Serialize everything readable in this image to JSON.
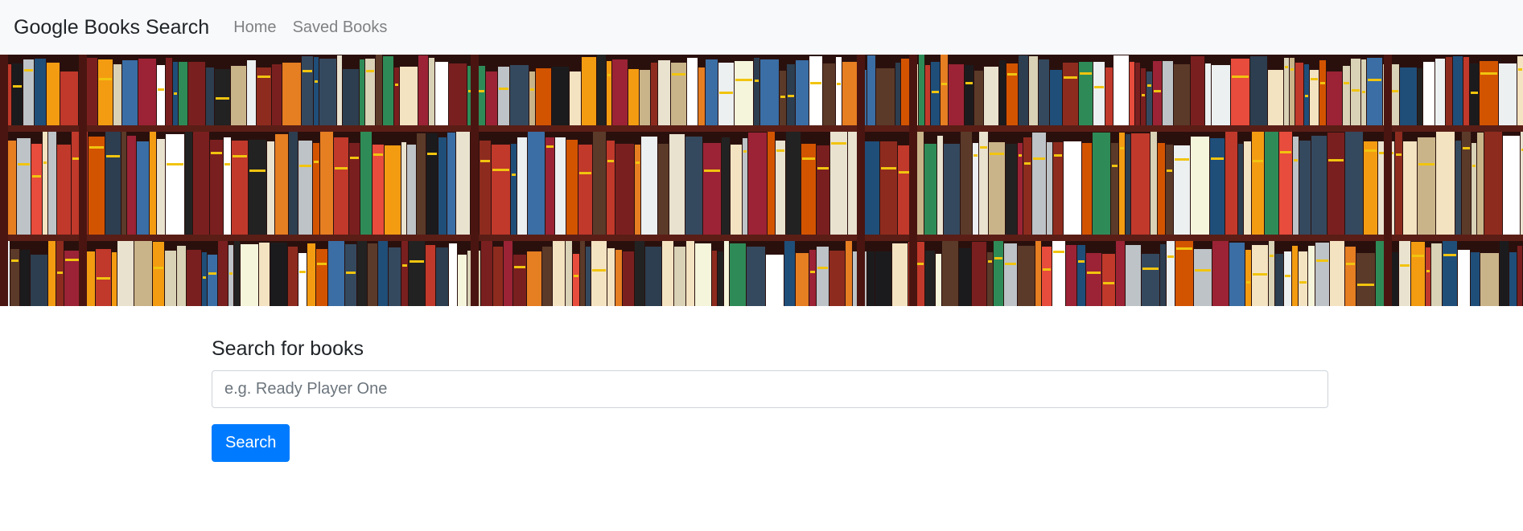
{
  "navbar": {
    "brand": "Google Books Search",
    "links": [
      {
        "label": "Home"
      },
      {
        "label": "Saved Books"
      }
    ]
  },
  "hero": {
    "image": "bookshelf-photo"
  },
  "search": {
    "label": "Search for books",
    "placeholder": "e.g. Ready Player One",
    "value": "",
    "button_label": "Search"
  },
  "colors": {
    "navbar_bg": "#f8f9fa",
    "primary": "#007bff",
    "shelf_wood": "#5a1e16"
  }
}
